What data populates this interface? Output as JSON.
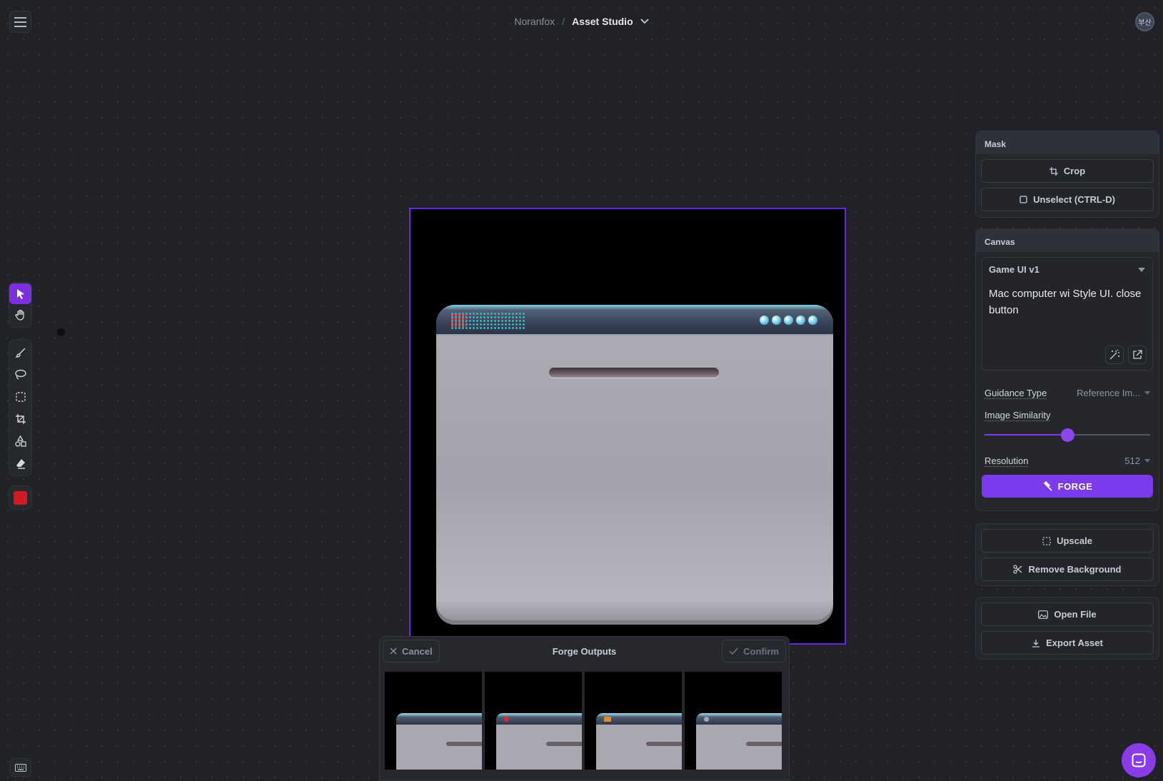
{
  "header": {
    "org": "Noranfox",
    "separator": "/",
    "project": "Asset Studio",
    "avatar_text": "부산"
  },
  "toolbar": {
    "tools": [
      "select-tool",
      "pan-tool",
      "brush-tool",
      "lasso-tool",
      "rect-select-tool",
      "crop-tool",
      "shapes-tool",
      "eraser-tool"
    ],
    "active_tool": "select-tool",
    "color": "#d11a24"
  },
  "mask_panel": {
    "title": "Mask",
    "crop_label": "Crop",
    "unselect_label": "Unselect (CTRL-D)"
  },
  "canvas_panel": {
    "title": "Canvas",
    "model": "Game UI v1",
    "prompt": "Mac computer wi Style UI.  close button",
    "guidance_label": "Guidance Type",
    "guidance_value": "Reference Im...",
    "similarity_label": "Image Similarity",
    "similarity_value": 0.5,
    "resolution_label": "Resolution",
    "resolution_value": "512",
    "forge_label": "FORGE"
  },
  "actions": {
    "upscale_label": "Upscale",
    "remove_bg_label": "Remove Background",
    "open_file_label": "Open File",
    "export_label": "Export Asset"
  },
  "outputs": {
    "title": "Forge Outputs",
    "cancel_label": "Cancel",
    "confirm_label": "Confirm",
    "thumbnails": [
      {
        "accent": "none"
      },
      {
        "accent": "#e02a2a"
      },
      {
        "accent": "#e08a2a"
      },
      {
        "accent": "#9aa8c8"
      }
    ]
  },
  "colors": {
    "accent": "#7c3aed",
    "background": "#202228"
  }
}
